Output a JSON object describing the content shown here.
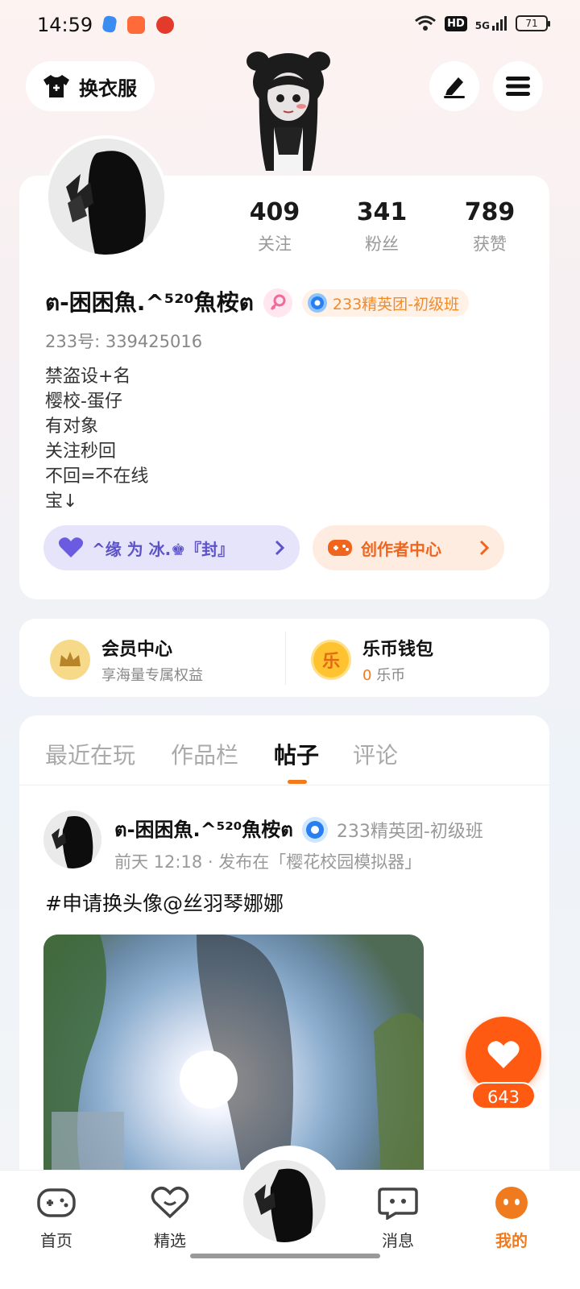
{
  "status_bar": {
    "time": "14:59",
    "network": "5G",
    "hd": "HD",
    "battery": "71"
  },
  "header": {
    "outfit_label": "换衣服"
  },
  "profile": {
    "stats": [
      {
        "value": "409",
        "label": "关注"
      },
      {
        "value": "341",
        "label": "粉丝"
      },
      {
        "value": "789",
        "label": "获赞"
      }
    ],
    "name": "ต-困困魚.^⁵²⁰魚桉ต",
    "level_tag": "233精英团-初级班",
    "uid": "233号: 339425016",
    "bio": [
      "禁盗设+名",
      "樱校-蛋仔",
      "有对象",
      "关注秒回",
      "不回=不在线",
      "宝↓"
    ],
    "relation_pill": "^缘  为  冰.♚『封』",
    "creator_pill": "创作者中心"
  },
  "member": {
    "vip_title": "会员中心",
    "vip_sub": "享海量专属权益",
    "wallet_title": "乐币钱包",
    "wallet_amount": "0",
    "wallet_unit": "乐币",
    "wallet_icon_text": "乐"
  },
  "tabs": [
    "最近在玩",
    "作品栏",
    "帖子",
    "评论"
  ],
  "active_tab": "帖子",
  "post": {
    "author": "ต-困困魚.^⁵²⁰魚桉ต",
    "badge": "233精英团-初级班",
    "meta": "前天 12:18 · 发布在「樱花校园模拟器」",
    "text": "#申请换头像@丝羽琴娜娜"
  },
  "like": {
    "count": "643"
  },
  "nav": [
    {
      "label": "首页"
    },
    {
      "label": "精选"
    },
    {
      "label": "消息"
    },
    {
      "label": "我的"
    }
  ],
  "colors": {
    "accent": "#f07b1e",
    "like": "#ff5a12",
    "relation": "#5c53c9"
  }
}
